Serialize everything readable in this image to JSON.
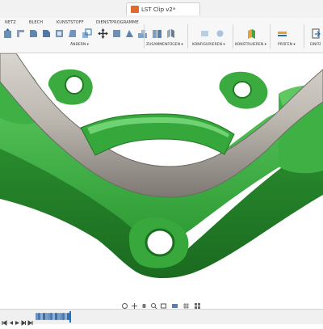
{
  "app": {
    "document_title": "LST Clip v2*"
  },
  "ribbon": {
    "tabs": [
      "NETZ",
      "BLECH",
      "KUNSTSTOFF",
      "DIENSTPROGRAMME"
    ],
    "groups": [
      "ÄNDERN ▾",
      "ZUSAMMENFÜGEN ▾",
      "KONFIGURIEREN ▾",
      "KONSTRUIEREN ▾",
      "PRÜFEN ▾",
      "EINFÜ"
    ]
  },
  "viewport": {
    "model_color": "#2fa336",
    "pipe_color": "#b8b3aa",
    "background": "#ffffff"
  },
  "navbar": {
    "icons": [
      "orbit-icon",
      "pan-icon",
      "hand-icon",
      "zoom-icon",
      "zoom-window-icon",
      "display-mode-icon",
      "grid-icon",
      "viewports-icon"
    ]
  },
  "timeline": {
    "controls": [
      "first-icon",
      "previous-icon",
      "play-icon",
      "next-icon",
      "last-icon"
    ],
    "feature_count": 14
  }
}
